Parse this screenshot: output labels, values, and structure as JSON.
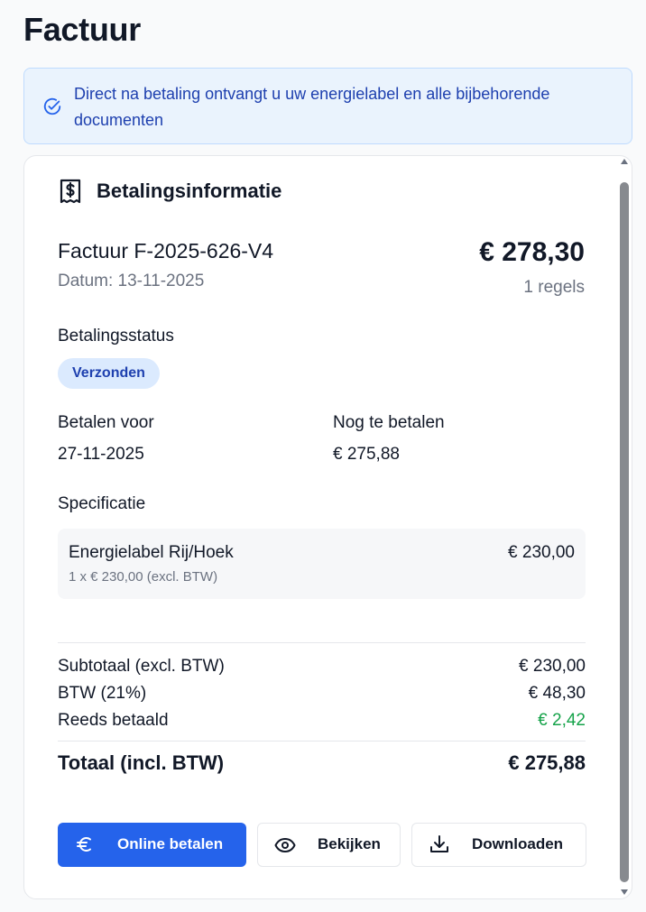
{
  "page": {
    "title": "Factuur"
  },
  "banner": {
    "text": "Direct na betaling ontvangt u uw energielabel en alle bijbehorende documenten",
    "icon": "check-circle-icon"
  },
  "card": {
    "title": "Betalingsinformatie",
    "icon": "receipt-dollar-icon",
    "invoice_number": "Factuur F-2025-626-V4",
    "date": "Datum: 13-11-2025",
    "amount": "€ 278,30",
    "lines": "1 regels",
    "status_label": "Betalingsstatus",
    "status_value": "Verzonden",
    "pay_before_label": "Betalen voor",
    "pay_before_value": "27-11-2025",
    "remaining_label": "Nog te betalen",
    "remaining_value": "€ 275,88",
    "spec_label": "Specificatie",
    "spec_items": [
      {
        "name": "Energielabel Rij/Hoek",
        "detail": "1 x € 230,00 (excl. BTW)",
        "price": "€ 230,00"
      }
    ],
    "summary": {
      "subtotal_label": "Subtotaal (excl. BTW)",
      "subtotal_value": "€ 230,00",
      "vat_label": "BTW (21%)",
      "vat_value": "€ 48,30",
      "paid_label": "Reeds betaald",
      "paid_value": "€ 2,42",
      "total_label": "Totaal (incl. BTW)",
      "total_value": "€ 275,88"
    },
    "buttons": {
      "pay": "Online betalen",
      "view": "Bekijken",
      "download": "Downloaden"
    }
  },
  "colors": {
    "primary": "#2563eb",
    "banner_bg": "#eaf3fd",
    "banner_text": "#1e40af",
    "paid_green": "#16a34a",
    "badge_bg": "#dbeafe"
  }
}
